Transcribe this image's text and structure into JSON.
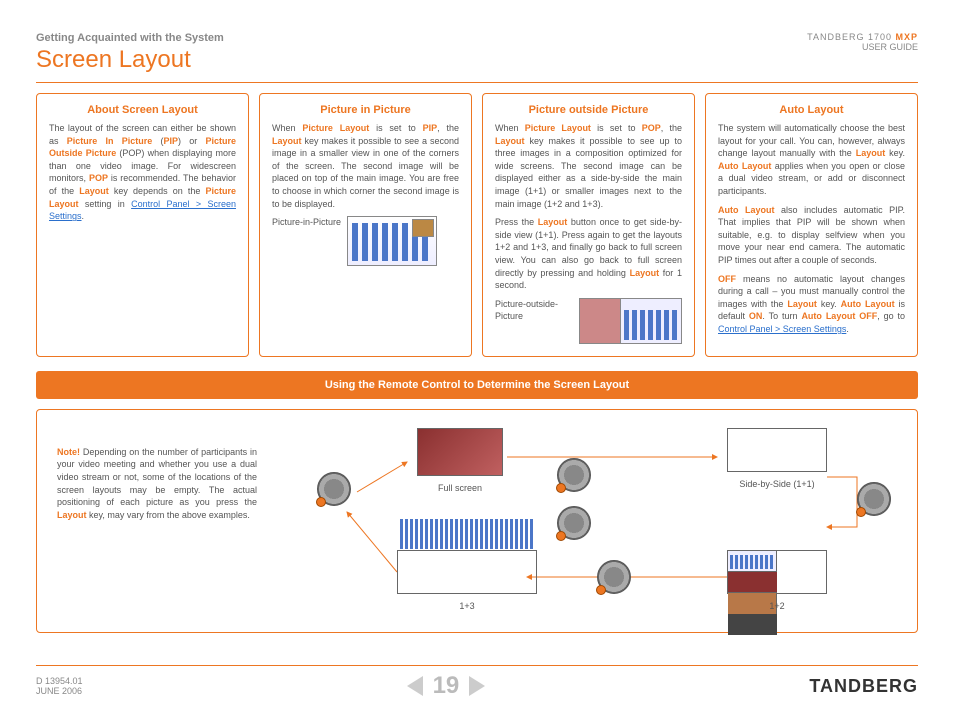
{
  "header": {
    "breadcrumb": "Getting Acquainted with the System",
    "title": "Screen Layout",
    "product": "TANDBERG 1700",
    "mxp": "MXP",
    "guide": "USER GUIDE"
  },
  "boxes": {
    "about": {
      "title": "About Screen Layout",
      "seg1": "The layout of the screen can either be shown as ",
      "k1": "Picture In Picture",
      "seg2": " (",
      "k2": "PIP",
      "seg3": ") or ",
      "k3": "Picture Outside Picture",
      "seg4": " (POP) when displaying more than one video image. For widescreen monitors, ",
      "k4": "POP",
      "seg5": " is recommended. The behavior of the ",
      "k5": "Layout",
      "seg6": " key depends on the ",
      "k6": "Picture Layout",
      "seg7": " setting in ",
      "link": "Control Panel > Screen Settings",
      "seg8": "."
    },
    "pip": {
      "title": "Picture in Picture",
      "seg1": "When ",
      "k1": "Picture Layout",
      "seg2": " is set to ",
      "k2": "PIP",
      "seg3": ", the ",
      "k3": "Layout",
      "seg4": " key makes it possible to see a second image in a smaller view in one of the corners of the screen. The second image will be placed on top of the main image. You are free to choose in which corner the second image is to be displayed.",
      "fig_label": "Picture-in-Picture"
    },
    "pop": {
      "title": "Picture outside Picture",
      "p1_seg1": "When ",
      "p1_k1": "Picture Layout",
      "p1_seg2": " is set to ",
      "p1_k2": "POP",
      "p1_seg3": ", the ",
      "p1_k3": "Layout",
      "p1_seg4": " key makes it possible to see up to three images in a composition optimized for wide screens. The second image can be displayed either as a side-by-side the main image (1+1) or smaller images next to the main image (1+2 and 1+3).",
      "p2_seg1": "Press the ",
      "p2_k1": "Layout",
      "p2_seg2": " button once to get side-by-side view (1+1). Press again to get the layouts 1+2 and 1+3, and finally go back to full screen view. You can also go back to full screen directly by pressing and holding ",
      "p2_k2": "Layout",
      "p2_seg3": " for 1 second.",
      "fig_label": "Picture-outside-Picture"
    },
    "auto": {
      "title": "Auto Layout",
      "p1_seg1": "The system will automatically choose the best layout for your call. You can, however, always change layout manually with the ",
      "p1_k1": "Layout",
      "p1_seg2": " key. ",
      "p1_k2": "Auto Layout",
      "p1_seg3": " applies when you open or close a dual video stream, or add or disconnect participants.",
      "p2_k1": "Auto Layout",
      "p2_seg1": " also includes automatic PIP. That implies that PIP will be shown when suitable, e.g. to display selfview when you move your near end camera. The automatic PIP times out after a couple of seconds.",
      "p3_k1": "OFF",
      "p3_seg1": " means no automatic layout changes during a call – you must manually control the images with the ",
      "p3_k2": "Layout",
      "p3_seg2": " key. ",
      "p3_k3": "Auto Layout",
      "p3_seg3": " is default ",
      "p3_k4": "ON",
      "p3_seg4": ". To turn ",
      "p3_k5": "Auto Layout OFF",
      "p3_seg5": ", go to ",
      "p3_link": "Control Panel > Screen Settings",
      "p3_seg6": "."
    }
  },
  "banner": "Using the Remote Control to Determine the Screen Layout",
  "diagram": {
    "note_k": "Note!",
    "note_seg1": " Depending on the number of participants in your video meeting and whether you use a dual video stream or not, some of the locations of the screen layouts may be empty. The actual positioning of each picture as you press the ",
    "note_k2": "Layout",
    "note_seg2": " key, may vary from the above examples.",
    "cap_full": "Full screen",
    "cap_sbs": "Side-by-Side (1+1)",
    "cap_13": "1+3",
    "cap_12": "1+2"
  },
  "footer": {
    "docid": "D 13954.01",
    "date": "JUNE 2006",
    "page": "19",
    "brand": "TANDBERG"
  }
}
